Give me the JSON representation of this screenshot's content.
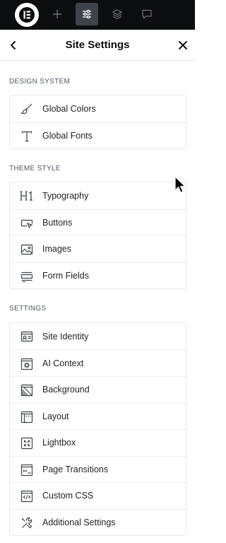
{
  "header": {
    "title": "Site Settings"
  },
  "sections": [
    {
      "label": "DESIGN SYSTEM",
      "items": [
        {
          "label": "Global Colors",
          "icon": "brush-icon"
        },
        {
          "label": "Global Fonts",
          "icon": "font-t-icon"
        }
      ]
    },
    {
      "label": "THEME STYLE",
      "items": [
        {
          "label": "Typography",
          "icon": "h1-icon"
        },
        {
          "label": "Buttons",
          "icon": "button-cursor-icon"
        },
        {
          "label": "Images",
          "icon": "image-icon"
        },
        {
          "label": "Form Fields",
          "icon": "form-field-icon"
        }
      ]
    },
    {
      "label": "SETTINGS",
      "items": [
        {
          "label": "Site Identity",
          "icon": "id-card-icon"
        },
        {
          "label": "AI Context",
          "icon": "ai-context-icon"
        },
        {
          "label": "Background",
          "icon": "background-icon"
        },
        {
          "label": "Layout",
          "icon": "layout-icon"
        },
        {
          "label": "Lightbox",
          "icon": "lightbox-icon"
        },
        {
          "label": "Page Transitions",
          "icon": "page-transitions-icon"
        },
        {
          "label": "Custom CSS",
          "icon": "custom-css-icon"
        },
        {
          "label": "Additional Settings",
          "icon": "tools-icon"
        }
      ]
    }
  ],
  "colors": {
    "topbar": "#0c0d0e",
    "active_tool": "#3f444b",
    "text": "#1f2124",
    "border": "#e6e8ea"
  }
}
